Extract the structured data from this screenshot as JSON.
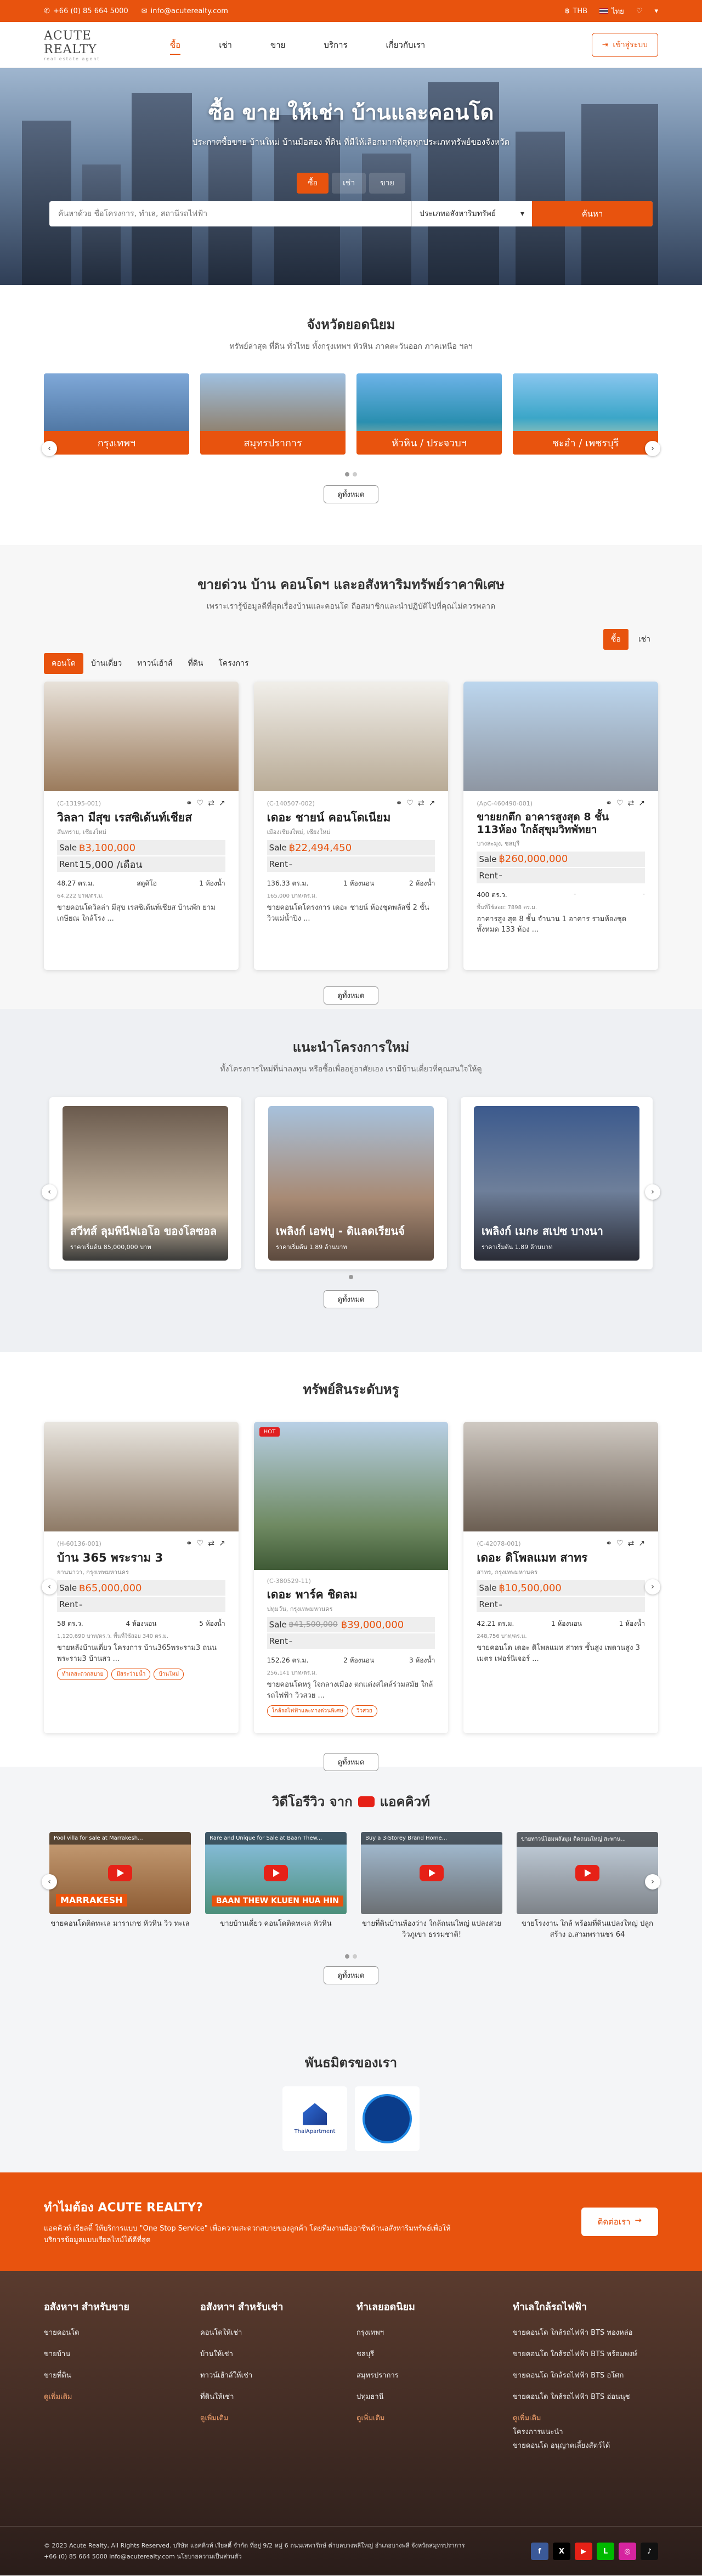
{
  "topbar": {
    "phone": "+66 (0) 85 664 5000",
    "email": "info@acuterealty.com",
    "currency": "THB",
    "language": "ไทย"
  },
  "header": {
    "logo": "ACUTE REALTY",
    "logo_sub": "real estate agent",
    "nav": [
      "ซื้อ",
      "เช่า",
      "ขาย",
      "บริการ",
      "เกี่ยวกับเรา"
    ],
    "login": "เข้าสู่ระบบ"
  },
  "hero": {
    "title": "ซื้อ ขาย ให้เช่า บ้านและคอนโด",
    "subtitle": "ประกาศซื้อขาย บ้านใหม่ บ้านมือสอง ที่ดิน ที่มีให้เลือกมากที่สุดทุกประเภททรัพย์ของจังหวัด",
    "tabs": [
      "ซื้อ",
      "เช่า",
      "ขาย"
    ],
    "search_placeholder": "ค้นหาด้วย ชื่อโครงการ, ทำเล, สถานีรถไฟฟ้า",
    "search_select": "ประเภทอสังหาริมทรัพย์",
    "search_button": "ค้นหา"
  },
  "provinces": {
    "title": "จังหวัดยอดนิยม",
    "subtitle": "ทรัพย์ล่าสุด ที่ดิน ทั่วไทย ทั้งกรุงเทพฯ หัวหิน ภาคตะวันออก ภาคเหนือ ฯลฯ",
    "items": [
      "กรุงเทพฯ",
      "สมุทรปราการ",
      "หัวหิน / ประจวบฯ",
      "ชะอำ / เพชรบุรี"
    ],
    "more": "ดูทั้งหมด"
  },
  "urgent": {
    "title": "ขายด่วน บ้าน คอนโดฯ และอสังหาริมทรัพย์ราคาพิเศษ",
    "subtitle": "เพราะเรารู้ข้อมูลดีที่สุดเรื่องบ้านและคอนโด ถือสมาชิกและนำปฏิบัติไปที่คุณไม่ควรพลาด",
    "mode": [
      "ซื้อ",
      "เช่า"
    ],
    "tabs": [
      "คอนโด",
      "บ้านเดี่ยว",
      "ทาวน์เฮ้าส์",
      "ที่ดิน",
      "โครงการ"
    ],
    "cards": [
      {
        "code": "(C-13195-001)",
        "title": "วิลลา มีสุข เรสซิเด้นท์เชียส",
        "loc": "สันทราย, เชียงใหม่",
        "sale": "฿3,100,000",
        "rent": "15,000 /เดือน",
        "area": "48.27 ตร.ม.",
        "beds": "สตูดิโอ",
        "baths": "1 ห้องน้ำ",
        "small": "64,222 บาท/ตร.ม.",
        "desc": "ขายคอนโดวิลล่า มีสุข เรสซิเด้นท์เชียส บ้านพัก ยามเกษียณ ใกล้โรง ..."
      },
      {
        "code": "(C-140507-002)",
        "title": "เดอะ ชายน์ คอนโดเนียม",
        "loc": "เมืองเชียงใหม่, เชียงใหม่",
        "sale": "฿22,494,450",
        "rent": "-",
        "area": "136.33 ตร.ม.",
        "beds": "1 ห้องนอน",
        "baths": "2 ห้องน้ำ",
        "small": "165,000 บาท/ตร.ม.",
        "desc": "ขายคอนโดโครงการ เดอะ ชายน์ ห้องชุดพลัสซี่ 2 ชั้น วิวแม่น้ำปิง ..."
      },
      {
        "code": "(ApC-460490-001)",
        "title": "ขายยกตึก อาคารสูงสุด 8 ชั้น 113ห้อง ใกล้สุขุมวิทพัทยา",
        "loc": "บางละมุง, ชลบุรี",
        "sale": "฿260,000,000",
        "rent": "-",
        "area": "400 ตร.ว.",
        "beds": "-",
        "baths": "-",
        "small": "พื้นที่ใช้สอย: 7898 ตร.ม.",
        "desc": "อาคารสูง สุด 8 ชั้น จำนวน 1 อาคาร รวมห้องชุดทั้งหมด 133 ห้อง ..."
      }
    ],
    "more": "ดูทั้งหมด"
  },
  "projects": {
    "title": "แนะนำโครงการใหม่",
    "subtitle": "ทั้งโครงการใหม่ที่น่าลงทุน หรือซื้อเพื่ออยู่อาศัยเอง เรามีบ้านเดี่ยวที่คุณสนใจให้ดู",
    "items": [
      {
        "name": "สวีทส์ ลุมพินีฟเอโอ ของโลซอล",
        "price": "ราคาเริ่มต้น 85,000,000 บาท"
      },
      {
        "name": "เพลิงก์ เอฟบู - ดิแลดเรียนจ์",
        "price": "ราคาเริ่มต้น 1.89 ล้านบาท"
      },
      {
        "name": "เพลิงก์ เมกะ สเปซ บางนา",
        "price": "ราคาเริ่มต้น 1.89 ล้านบาท"
      }
    ],
    "more": "ดูทั้งหมด"
  },
  "luxury": {
    "title": "ทรัพย์สินระดับหรู",
    "cards": [
      {
        "code": "(H-60136-001)",
        "title": "บ้าน 365 พระราม 3",
        "loc": "ยานนาวา, กรุงเทพมหานคร",
        "sale": "฿65,000,000",
        "rent": "-",
        "area": "58 ตร.ว.",
        "beds": "4 ห้องนอน",
        "baths": "5 ห้องน้ำ",
        "small": "1,120,690 บาท/ตร.ว.  พื้นที่ใช้สอย 340 ตร.ม.",
        "desc": "ขายหลังบ้านเดี่ยว โครงการ บ้าน365พระราม3 ถนนพระราม3 บ้านสว ...",
        "tags": [
          "ทำเลสะดวกสบาย",
          "มีสระว่ายน้ำ",
          "บ้านใหม่"
        ]
      },
      {
        "code": "(C-380529-11)",
        "title": "เดอะ พาร์ค ชิดลม",
        "loc": "ปทุมวัน, กรุงเทพมหานคร",
        "sale_old": "฿41,500,000",
        "sale": "฿39,000,000",
        "rent": "-",
        "area": "152.26 ตร.ม.",
        "beds": "2 ห้องนอน",
        "baths": "3 ห้องน้ำ",
        "small": "256,141 บาท/ตร.ม.",
        "desc": "ขายคอนโดหรู ใจกลางเมือง ตกแต่งสไตล์ร่วมสมัย ใกล้รถไฟฟ้า วิวสวย ...",
        "tags": [
          "ใกล้รถไฟฟ้าและทางด่วนพิเศษ",
          "วิวสวย"
        ],
        "hot": "HOT"
      },
      {
        "code": "(C-42078-001)",
        "title": "เดอะ ดิโพลแมท สาทร",
        "loc": "สาทร, กรุงเทพมหานคร",
        "sale": "฿10,500,000",
        "rent": "-",
        "area": "42.21 ตร.ม.",
        "beds": "1 ห้องนอน",
        "baths": "1 ห้องน้ำ",
        "small": "248,756 บาท/ตร.ม.",
        "desc": "ขายคอนโด เดอะ ดิโพลแมท สาทร ชั้นสูง เพดานสูง 3 เมตร เฟอร์นิเจอร์ ..."
      }
    ],
    "more": "ดูทั้งหมด"
  },
  "videos": {
    "title_pre": "วิดีโอรีวิว จาก",
    "title_post": "แอคคิวท์",
    "items": [
      {
        "top": "Pool villa for sale at Marrakesh...",
        "banner": "MARRAKESH",
        "cap": "ขายคอนโดติดทะเล มาราเกช หัวหิน วิว ทะเล"
      },
      {
        "top": "Rare and Unique for Sale at Baan Thew...",
        "banner": "BAAN THEW KLUEN HUA HIN",
        "cap": "ขายบ้านเดี่ยว คอนโดติดทะเล หัวหิน"
      },
      {
        "top": "Buy a 3-Storey Brand Home...",
        "banner": "",
        "cap": "ขายที่ดินบ้านห้องว่าง ใกล้ถนนใหญ่ แปลงสวย วิวภูเขา ธรรมชาติ!"
      },
      {
        "top": "ขายทาวน์โฮมหลังมุม ติดถนนใหญ่ สะพาน...",
        "banner": "",
        "cap": "ขายโรงงาน ใกล้ พร้อมที่ดินแปลงใหญ่ ปลูกสร้าง อ.สามพรานชร 64"
      }
    ],
    "more": "ดูทั้งหมด"
  },
  "partners": {
    "title": "พันธมิตรของเรา",
    "items": [
      "ThaiApartment"
    ]
  },
  "cta": {
    "title": "ทำไมต้อง ACUTE REALTY?",
    "text": "แอคคิวท์ เรียลตี้ ให้บริการแบบ \"One Stop Service\" เพื่อความสะดวกสบายของลูกค้า โดยทีมงานมืออาชีพด้านอสังหาริมทรัพย์เพื่อให้บริการข้อมูลแบบเรียลไทม์ได้ดีที่สุด",
    "button": "ติดต่อเรา"
  },
  "footer": {
    "cols": [
      {
        "title": "อสังหาฯ สำหรับขาย",
        "items": [
          "ขายคอนโด",
          "ขายบ้าน",
          "ขายที่ดิน",
          "ดูเพิ่มเติม"
        ]
      },
      {
        "title": "อสังหาฯ สำหรับเช่า",
        "items": [
          "คอนโดให้เช่า",
          "บ้านให้เช่า",
          "ทาวน์เฮ้าส์ให้เช่า",
          "ที่ดินให้เช่า",
          "ดูเพิ่มเติม"
        ]
      },
      {
        "title": "ทำเลยอดนิยม",
        "items": [
          "กรุงเทพฯ",
          "ชลบุรี",
          "สมุทรปราการ",
          "ปทุมธานี",
          "ดูเพิ่มเติม"
        ]
      },
      {
        "title": "ทำเลใกล้รถไฟฟ้า",
        "items": [
          "ขายคอนโด ใกล้รถไฟฟ้า BTS ทองหล่อ",
          "ขายคอนโด ใกล้รถไฟฟ้า BTS พร้อมพงษ์",
          "ขายคอนโด ใกล้รถไฟฟ้า BTS อโศก",
          "ขายคอนโด ใกล้รถไฟฟ้า BTS อ่อนนุช",
          "ดูเพิ่มเติม",
          "โครงการแนะนำ",
          "ขายคอนโด อนุญาตเลี้ยงสัตว์ได้"
        ]
      }
    ],
    "copyright": "© 2023 Acute Realty, All Rights Reserved. บริษัท แอคคิวท์ เรียลตี้ จำกัด  ที่อยู่ 9/2 หมู่ 6 ถนนเทพารักษ์ ตำบลบางพลีใหญ่ อำเภอบางพลี จังหวัดสมุทรปราการ",
    "contact": "+66 (0) 85 664 5000  info@acuterealty.com  นโยบายความเป็นส่วนตัว"
  },
  "colors": {
    "accent": "#e8530e",
    "hot": "#e02020"
  }
}
